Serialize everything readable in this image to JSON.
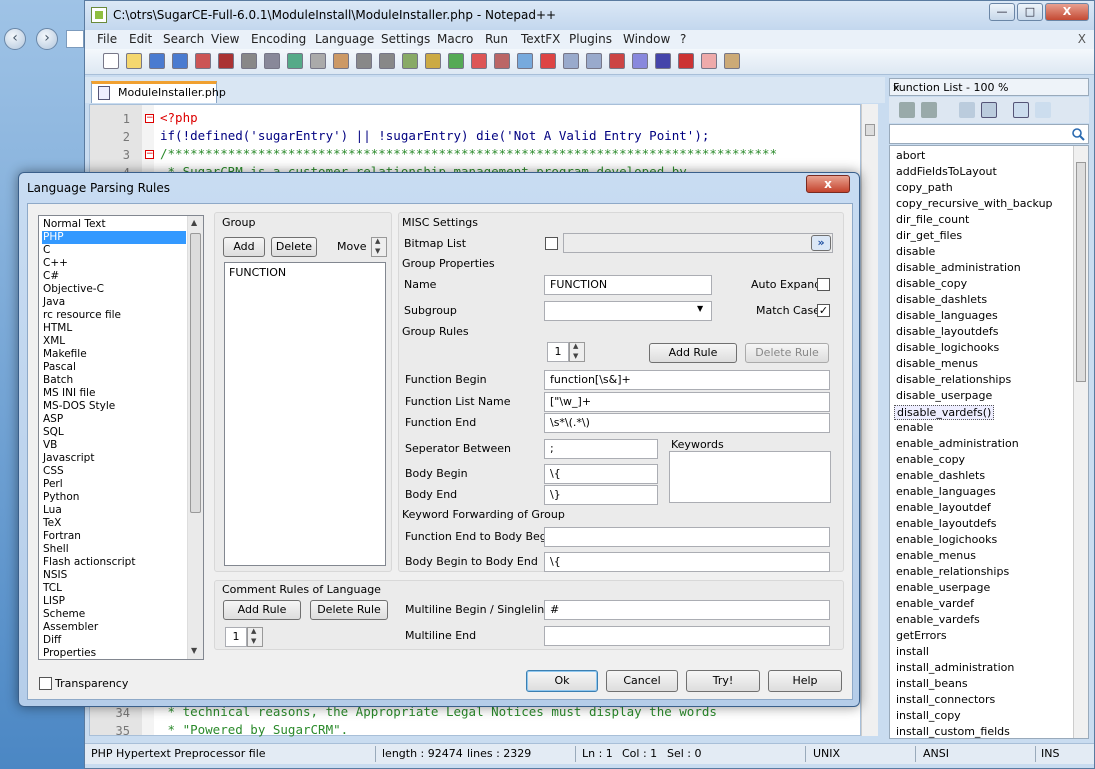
{
  "window": {
    "title": "C:\\otrs\\SugarCE-Full-6.0.1\\ModuleInstall\\ModuleInstaller.php - Notepad++",
    "minimize": "—",
    "maximize": "□",
    "close": "X",
    "inner_close": "X"
  },
  "menu": [
    "File",
    "Edit",
    "Search",
    "View",
    "Encoding",
    "Language",
    "Settings",
    "Macro",
    "Run",
    "TextFX",
    "Plugins",
    "Window",
    "?"
  ],
  "editor": {
    "tab_label": "ModuleInstaller.php",
    "lines": [
      {
        "n": "1",
        "text": "<?php",
        "fold": "−"
      },
      {
        "n": "2",
        "text": "if(!defined('sugarEntry') || !sugarEntry) die('Not A Valid Entry Point');",
        "fold": ""
      },
      {
        "n": "3",
        "text": "/*********************************************************************************",
        "fold": "−"
      },
      {
        "n": "4",
        "text": " * SugarCRM is a customer relationship management program developed by",
        "fold": ""
      }
    ],
    "bottom_lines": [
      {
        "n": "34",
        "text": " * technical reasons, the Appropriate Legal Notices must display the words"
      },
      {
        "n": "35",
        "text": " * \"Powered by SugarCRM\"."
      }
    ]
  },
  "function_list": {
    "title": "Function List - 100 %",
    "close": "x",
    "search_icon": "magnifier-icon",
    "items": [
      "abort",
      "addFieldsToLayout",
      "copy_path",
      "copy_recursive_with_backup",
      "dir_file_count",
      "dir_get_files",
      "disable",
      "disable_administration",
      "disable_copy",
      "disable_dashlets",
      "disable_languages",
      "disable_layoutdefs",
      "disable_logichooks",
      "disable_menus",
      "disable_relationships",
      "disable_userpage",
      "disable_vardefs()",
      "enable",
      "enable_administration",
      "enable_copy",
      "enable_dashlets",
      "enable_languages",
      "enable_layoutdef",
      "enable_layoutdefs",
      "enable_logichooks",
      "enable_menus",
      "enable_relationships",
      "enable_userpage",
      "enable_vardef",
      "enable_vardefs",
      "getErrors",
      "install",
      "install_administration",
      "install_beans",
      "install_connectors",
      "install_copy",
      "install_custom_fields"
    ],
    "selected": "disable_vardefs()"
  },
  "status": {
    "file_type": "PHP Hypertext Preprocessor file",
    "length": "length : 92474",
    "lines": "lines : 2329",
    "ln": "Ln : 1",
    "col": "Col : 1",
    "sel": "Sel : 0",
    "eol": "UNIX",
    "encoding": "ANSI",
    "mode": "INS"
  },
  "dialog": {
    "title": "Language Parsing Rules",
    "close": "x",
    "languages": [
      "Normal Text",
      "PHP",
      "C",
      "C++",
      "C#",
      "Objective-C",
      "Java",
      "rc resource file",
      "HTML",
      "XML",
      "Makefile",
      "Pascal",
      "Batch",
      "MS INI file",
      "MS-DOS Style",
      "ASP",
      "SQL",
      "VB",
      "Javascript",
      "CSS",
      "Perl",
      "Python",
      "Lua",
      "TeX",
      "Fortran",
      "Shell",
      "Flash actionscript",
      "NSIS",
      "TCL",
      "LISP",
      "Scheme",
      "Assembler",
      "Diff",
      "Properties"
    ],
    "selected_language": "PHP",
    "group": {
      "label": "Group",
      "add": "Add",
      "delete": "Delete",
      "move": "Move",
      "items": [
        "FUNCTION"
      ]
    },
    "misc": {
      "label": "MISC Settings",
      "bitmap_list": "Bitmap List",
      "browse": "»"
    },
    "group_properties": {
      "label": "Group Properties",
      "name_label": "Name",
      "name_value": "FUNCTION",
      "auto_expand": "Auto Expand",
      "subgroup_label": "Subgroup",
      "subgroup_value": "",
      "match_case": "Match Case",
      "match_case_checked": "✓"
    },
    "group_rules": {
      "label": "Group Rules",
      "rule_number": "1",
      "add_rule": "Add Rule",
      "delete_rule": "Delete Rule",
      "function_begin_label": "Function Begin",
      "function_begin": "function[\\s&]+",
      "function_list_name_label": "Function List Name",
      "function_list_name": "[\"\\w_]+",
      "function_end_label": "Function End",
      "function_end": "\\s*\\(.*\\)",
      "separator_label": "Seperator Between",
      "separator": ";",
      "keywords_label": "Keywords",
      "body_begin_label": "Body Begin",
      "body_begin": "\\{",
      "body_end_label": "Body End",
      "body_end": "\\}"
    },
    "keyword_forwarding": {
      "label": "Keyword Forwarding of Group",
      "fe_to_bb_label": "Function End to Body Begin",
      "fe_to_bb": "",
      "bb_to_be_label": "Body Begin to Body End",
      "bb_to_be": "\\{"
    },
    "comment_rules": {
      "label": "Comment Rules of Language",
      "add_rule": "Add Rule",
      "delete_rule": "Delete Rule",
      "rule_number": "1",
      "multiline_begin_label": "Multiline Begin / Singleline",
      "multiline_begin": "#",
      "multiline_end_label": "Multiline End",
      "multiline_end": ""
    },
    "transparency": "Transparency",
    "buttons": {
      "ok": "Ok",
      "cancel": "Cancel",
      "try": "Try!",
      "help": "Help"
    }
  }
}
